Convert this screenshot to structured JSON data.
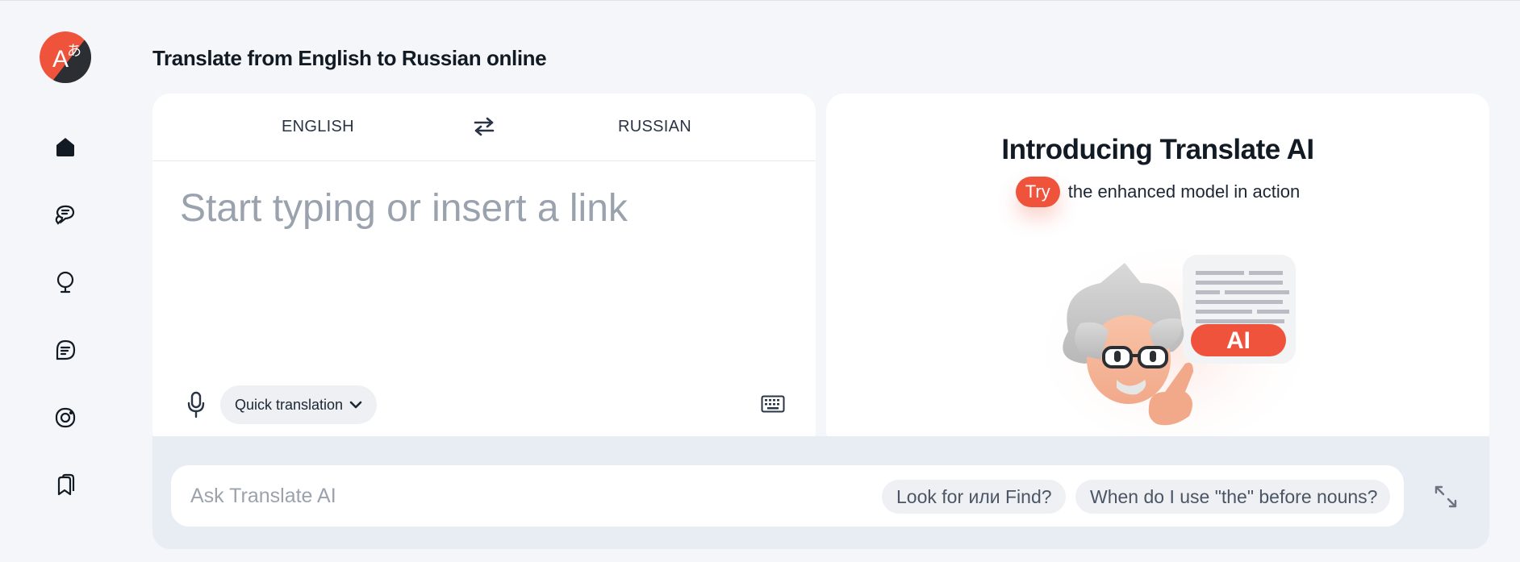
{
  "page": {
    "title": "Translate from English to Russian online"
  },
  "sidebar": {
    "logo": {
      "icon": "translate-logo-icon",
      "letter": "A",
      "glyph": "あ"
    },
    "items": [
      {
        "icon": "home-icon"
      },
      {
        "icon": "chat-bubbles-icon"
      },
      {
        "icon": "lightbulb-icon"
      },
      {
        "icon": "document-text-icon"
      },
      {
        "icon": "camera-icon"
      },
      {
        "icon": "bookmarks-icon"
      }
    ]
  },
  "translator": {
    "source_lang": "ENGLISH",
    "target_lang": "RUSSIAN",
    "swap_icon": "swap-arrows-icon",
    "source_value": "",
    "source_placeholder": "Start typing or insert a link",
    "mic_icon": "microphone-icon",
    "quick_label": "Quick translation",
    "keyboard_icon": "keyboard-icon"
  },
  "promo": {
    "title": "Introducing Translate AI",
    "try_label": "Try",
    "subtitle": "the enhanced model in action",
    "ai_badge": "AI"
  },
  "ask": {
    "value": "",
    "placeholder": "Ask Translate AI",
    "suggestions": [
      "Look for или Find?",
      "When do I use \"the\" before nouns?"
    ],
    "expand_icon": "expand-icon"
  },
  "colors": {
    "accent": "#f0533c",
    "text": "#121a24",
    "placeholder": "#9aa3ad",
    "background": "#f5f6f9",
    "chip": "#eef0f4"
  }
}
